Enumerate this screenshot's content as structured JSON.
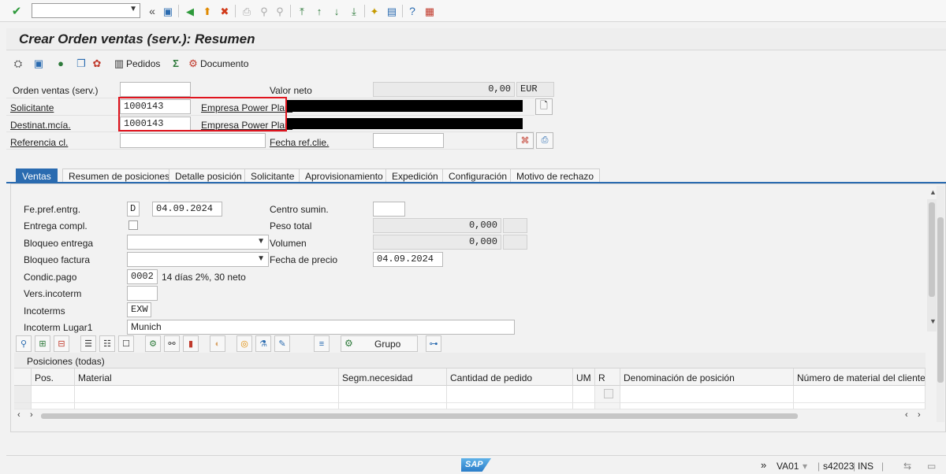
{
  "toolbar": {
    "command_value": "",
    "icons": [
      "enter-icon",
      "command-dropdown",
      "back-arrows-icon",
      "save-icon",
      "back-icon",
      "exit-icon",
      "cancel-icon",
      "print-icon",
      "find-icon",
      "find-next-icon",
      "first-page-icon",
      "previous-page-icon",
      "next-page-icon",
      "last-page-icon",
      "create-session-icon",
      "shortcut-icon",
      "help-icon",
      "customize-layout-icon"
    ]
  },
  "title": "Crear Orden ventas (serv.): Resumen",
  "app_toolbar": {
    "pedidos_label": "Pedidos",
    "documento_label": "Documento"
  },
  "header": {
    "orden_label": "Orden ventas (serv.)",
    "orden_value": "",
    "valor_neto_label": "Valor neto",
    "valor_neto_value": "0,00",
    "currency": "EUR",
    "solicitante_label": "Solicitante",
    "solicitante_value": "1000143",
    "solicitante_name": "Empresa Power Plant",
    "destinat_label": "Destinat.mcía.",
    "destinat_value": "1000143",
    "destinat_name": "Empresa Power Plant",
    "referencia_label": "Referencia cl.",
    "referencia_value": "",
    "fecha_ref_label": "Fecha ref.clie.",
    "fecha_ref_value": ""
  },
  "tabs": [
    {
      "label": "Ventas"
    },
    {
      "label": "Resumen de posiciones"
    },
    {
      "label": "Detalle posición"
    },
    {
      "label": "Solicitante"
    },
    {
      "label": "Aprovisionamiento"
    },
    {
      "label": "Expedición"
    },
    {
      "label": "Configuración"
    },
    {
      "label": "Motivo de rechazo"
    }
  ],
  "ventas": {
    "fe_pref_label": "Fe.pref.entrg.",
    "fe_pref_type": "D",
    "fe_pref_value": "04.09.2024",
    "centro_label": "Centro sumin.",
    "centro_value": "",
    "entrega_label": "Entrega compl.",
    "peso_label": "Peso total",
    "peso_value": "0,000",
    "bloqueo_entrega_label": "Bloqueo entrega",
    "bloqueo_entrega_value": "",
    "volumen_label": "Volumen",
    "volumen_value": "0,000",
    "bloqueo_factura_label": "Bloqueo factura",
    "bloqueo_factura_value": "",
    "fecha_precio_label": "Fecha de precio",
    "fecha_precio_value": "04.09.2024",
    "condic_label": "Condic.pago",
    "condic_value": "0002",
    "condic_text": "14 días 2%, 30 neto",
    "vers_label": "Vers.incoterm",
    "vers_value": "",
    "incoterms_label": "Incoterms",
    "incoterms_value": "EXW",
    "lugar_label": "Incoterm Lugar1",
    "lugar_value": "Munich"
  },
  "table": {
    "grupo_label": "Grupo",
    "title": "Posiciones (todas)",
    "columns": [
      "Pos.",
      "Material",
      "Segm.necesidad",
      "Cantidad de pedido",
      "UM",
      "R",
      "Denominación de posición",
      "Número de material del cliente"
    ]
  },
  "status": {
    "arrows": "»",
    "transaction": "VA01",
    "server": "s42023",
    "mode": "INS",
    "logo": "SAP"
  },
  "colors": {
    "accent": "#2a6bb0",
    "highlight_box": "#e0141e"
  }
}
